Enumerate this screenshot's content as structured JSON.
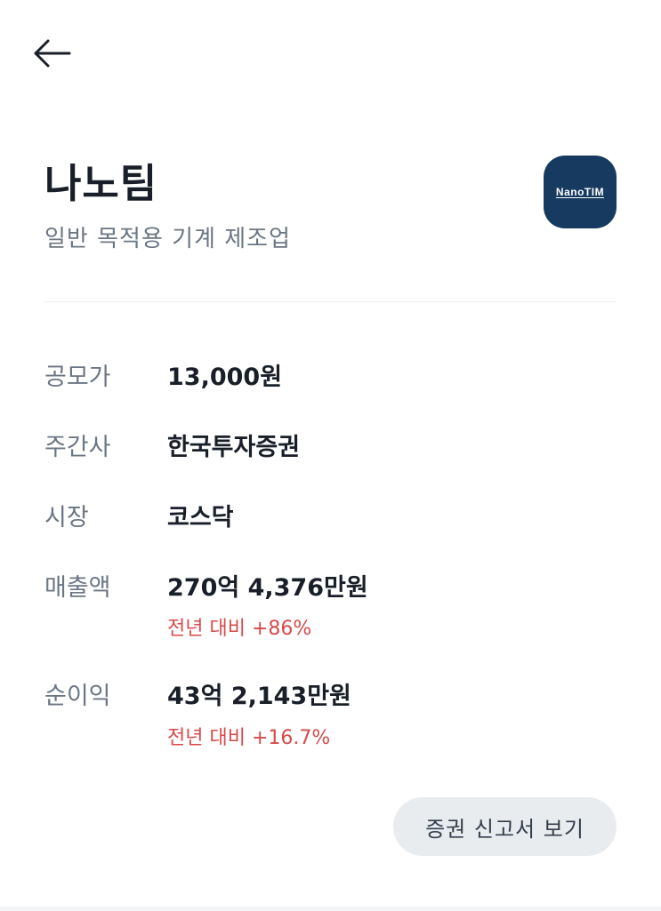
{
  "header": {
    "back_icon": "arrow-left-icon"
  },
  "company": {
    "name": "나노팀",
    "industry": "일반 목적용 기계 제조업",
    "logo_text": "NanoTIM",
    "logo_bg": "#173a60"
  },
  "info": {
    "offer_price": {
      "label": "공모가",
      "value": "13,000원"
    },
    "underwriter": {
      "label": "주간사",
      "value": "한국투자증권"
    },
    "market": {
      "label": "시장",
      "value": "코스닥"
    },
    "revenue": {
      "label": "매출액",
      "value": "270억 4,376만원",
      "change": "전년 대비 +86%"
    },
    "net_income": {
      "label": "순이익",
      "value": "43억 2,143만원",
      "change": "전년 대비 +16.7%"
    }
  },
  "actions": {
    "report_button": "증권 신고서 보기"
  },
  "colors": {
    "accent_red": "#d94a4a",
    "label_gray": "#6b7684",
    "text_dark": "#191f28"
  }
}
